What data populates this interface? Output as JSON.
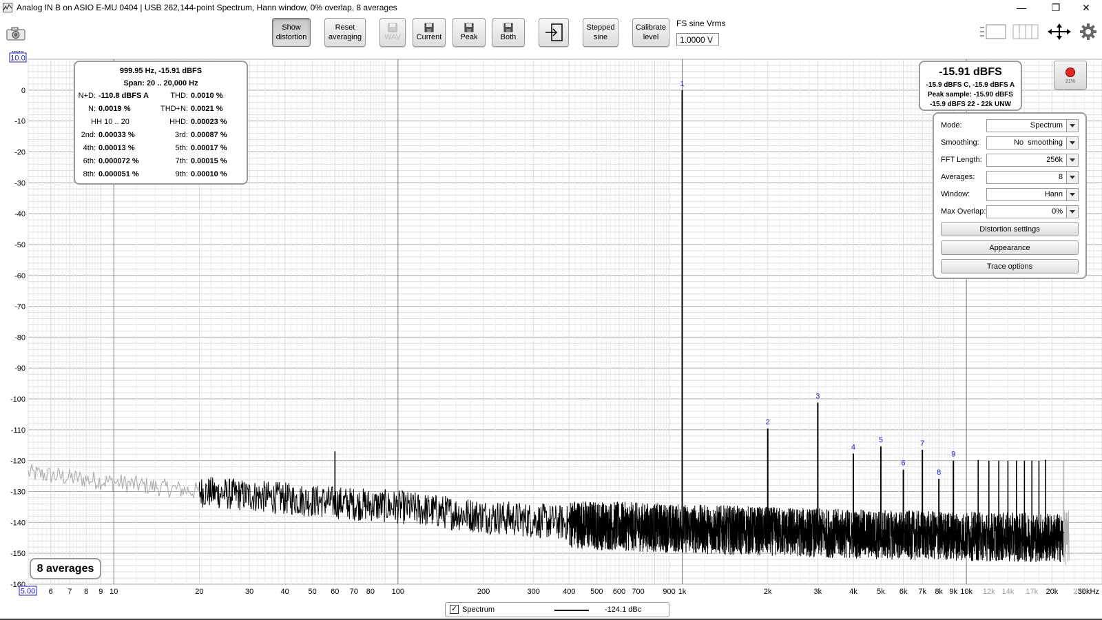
{
  "window": {
    "title": "Analog IN B on ASIO E-MU 0404 | USB 262,144-point Spectrum, Hann window, 0% overlap, 8 averages",
    "controls": [
      "—",
      "❐",
      "✕"
    ]
  },
  "toolbar": {
    "show_distortion": [
      "Show",
      "distortion"
    ],
    "reset_averaging": [
      "Reset",
      "averaging"
    ],
    "wav": "WAV",
    "current": "Current",
    "peak": "Peak",
    "both": "Both",
    "stepped_sine": [
      "Stepped",
      "sine"
    ],
    "calibrate_level": [
      "Calibrate",
      "level"
    ],
    "fs_label": "FS sine Vrms",
    "fs_value": "1.0000 V"
  },
  "distortion": {
    "header": "999.95 Hz, -15.91 dBFS",
    "span": "Span: 20 .. 20,000 Hz",
    "rows": [
      {
        "l1": "N+D:",
        "v1": "-110.8 dBFS A",
        "l2": "THD:",
        "v2": "0.0010 %"
      },
      {
        "l1": "N:",
        "v1": "0.0019 %",
        "l2": "THD+N:",
        "v2": "0.0021 %"
      },
      {
        "l1": "HH 10 .. 20",
        "v1": "",
        "l2": "HHD:",
        "v2": "0.00023 %"
      },
      {
        "l1": "2nd:",
        "v1": "0.00033 %",
        "l2": "3rd:",
        "v2": "0.00087 %"
      },
      {
        "l1": "4th:",
        "v1": "0.00013 %",
        "l2": "5th:",
        "v2": "0.00017 %"
      },
      {
        "l1": "6th:",
        "v1": "0.000072 %",
        "l2": "7th:",
        "v2": "0.00015 %"
      },
      {
        "l1": "8th:",
        "v1": "0.000051 %",
        "l2": "9th:",
        "v2": "0.00010 %"
      }
    ]
  },
  "level": {
    "main": "-15.91 dBFS",
    "line1": "-15.9 dBFS C, -15.9 dBFS A",
    "line2": "Peak sample: -15.90 dBFS",
    "line3": "-15.9 dBFS 22 - 22k UNW",
    "record_percent": "21%",
    "record_color": "#e0281e"
  },
  "settings": {
    "rows": [
      {
        "label": "Mode:",
        "value": "Spectrum"
      },
      {
        "label": "Smoothing:",
        "value": "No  smoothing"
      },
      {
        "label": "FFT Length:",
        "value": "256k"
      },
      {
        "label": "Averages:",
        "value": "8"
      },
      {
        "label": "Window:",
        "value": "Hann"
      },
      {
        "label": "Max Overlap:",
        "value": "0%"
      }
    ],
    "buttons": [
      "Distortion settings",
      "Appearance",
      "Trace options"
    ]
  },
  "badge": {
    "averages": "8 averages"
  },
  "legend": {
    "name": "Spectrum",
    "value": "-124.1 dBc",
    "checked": true
  },
  "chart_data": {
    "type": "line",
    "y_unit": "dBc",
    "ylim": [
      -160,
      10.0
    ],
    "xlim": [
      5.0,
      30000
    ],
    "x_scale": "log",
    "y_ticks": [
      0,
      -10,
      -20,
      -30,
      -40,
      -50,
      -60,
      -70,
      -80,
      -90,
      -100,
      -110,
      -120,
      -130,
      -140,
      -150,
      -160
    ],
    "y_top_label": "10.0",
    "x_start_label": "5.00",
    "x_tick_labels": [
      {
        "f": 6,
        "t": "6"
      },
      {
        "f": 7,
        "t": "7"
      },
      {
        "f": 8,
        "t": "8"
      },
      {
        "f": 9,
        "t": "9"
      },
      {
        "f": 10,
        "t": "10"
      },
      {
        "f": 20,
        "t": "20"
      },
      {
        "f": 30,
        "t": "30"
      },
      {
        "f": 40,
        "t": "40"
      },
      {
        "f": 50,
        "t": "50"
      },
      {
        "f": 60,
        "t": "60"
      },
      {
        "f": 70,
        "t": "70"
      },
      {
        "f": 80,
        "t": "80"
      },
      {
        "f": 100,
        "t": "100"
      },
      {
        "f": 200,
        "t": "200"
      },
      {
        "f": 300,
        "t": "300"
      },
      {
        "f": 400,
        "t": "400"
      },
      {
        "f": 500,
        "t": "500"
      },
      {
        "f": 600,
        "t": "600"
      },
      {
        "f": 700,
        "t": "700"
      },
      {
        "f": 900,
        "t": "900"
      },
      {
        "f": 1000,
        "t": "1k"
      },
      {
        "f": 2000,
        "t": "2k"
      },
      {
        "f": 3000,
        "t": "3k"
      },
      {
        "f": 4000,
        "t": "4k"
      },
      {
        "f": 5000,
        "t": "5k"
      },
      {
        "f": 6000,
        "t": "6k"
      },
      {
        "f": 7000,
        "t": "7k"
      },
      {
        "f": 8000,
        "t": "8k"
      },
      {
        "f": 9000,
        "t": "9k"
      },
      {
        "f": 10000,
        "t": "10k"
      },
      {
        "f": 12000,
        "t": "12k"
      },
      {
        "f": 14000,
        "t": "14k"
      },
      {
        "f": 17000,
        "t": "17k"
      },
      {
        "f": 20000,
        "t": "20k"
      },
      {
        "f": 25000,
        "t": "25k"
      },
      {
        "f": 30000,
        "t": "30kHz"
      }
    ],
    "grey_tick_labels": [
      "12k",
      "14k",
      "17k",
      "25k"
    ],
    "fundamental": {
      "f": 1000,
      "db": 0,
      "label": "1"
    },
    "harmonics": [
      {
        "n": 2,
        "f": 2000,
        "db": -109.6,
        "label": "2"
      },
      {
        "n": 3,
        "f": 3000,
        "db": -101.2,
        "label": "3"
      },
      {
        "n": 4,
        "f": 4000,
        "db": -117.7,
        "label": "4"
      },
      {
        "n": 5,
        "f": 5000,
        "db": -115.4,
        "label": "5"
      },
      {
        "n": 6,
        "f": 6000,
        "db": -122.9,
        "label": "6"
      },
      {
        "n": 7,
        "f": 7000,
        "db": -116.5,
        "label": "7"
      },
      {
        "n": 8,
        "f": 8000,
        "db": -125.9,
        "label": "8"
      },
      {
        "n": 9,
        "f": 9000,
        "db": -120.0,
        "label": "9"
      }
    ],
    "spurs": [
      {
        "f": 60,
        "db": -117.0
      },
      {
        "f": 11000,
        "db": -119.8
      },
      {
        "f": 12000,
        "db": -120.0
      },
      {
        "f": 13000,
        "db": -120.0
      },
      {
        "f": 14000,
        "db": -120.0
      },
      {
        "f": 15000,
        "db": -120.0
      },
      {
        "f": 16000,
        "db": -120.0
      },
      {
        "f": 17000,
        "db": -120.0
      },
      {
        "f": 18000,
        "db": -120.0
      },
      {
        "f": 19000,
        "db": -119.7
      }
    ],
    "noise_floor": [
      {
        "f": 5,
        "db": -124
      },
      {
        "f": 10,
        "db": -127
      },
      {
        "f": 20,
        "db": -130
      },
      {
        "f": 50,
        "db": -133
      },
      {
        "f": 100,
        "db": -135
      },
      {
        "f": 200,
        "db": -138
      },
      {
        "f": 500,
        "db": -141
      },
      {
        "f": 1000,
        "db": -142
      },
      {
        "f": 5000,
        "db": -144
      },
      {
        "f": 20000,
        "db": -145
      },
      {
        "f": 22000,
        "db": -145
      }
    ],
    "out_of_band_above": 20000,
    "colors": {
      "trace": "#000000",
      "out_of_band": "#b0b0b0",
      "grid_major": "#a8a8a8",
      "grid_minor": "#dcdcdc",
      "label_blue": "#1a1aff"
    }
  }
}
